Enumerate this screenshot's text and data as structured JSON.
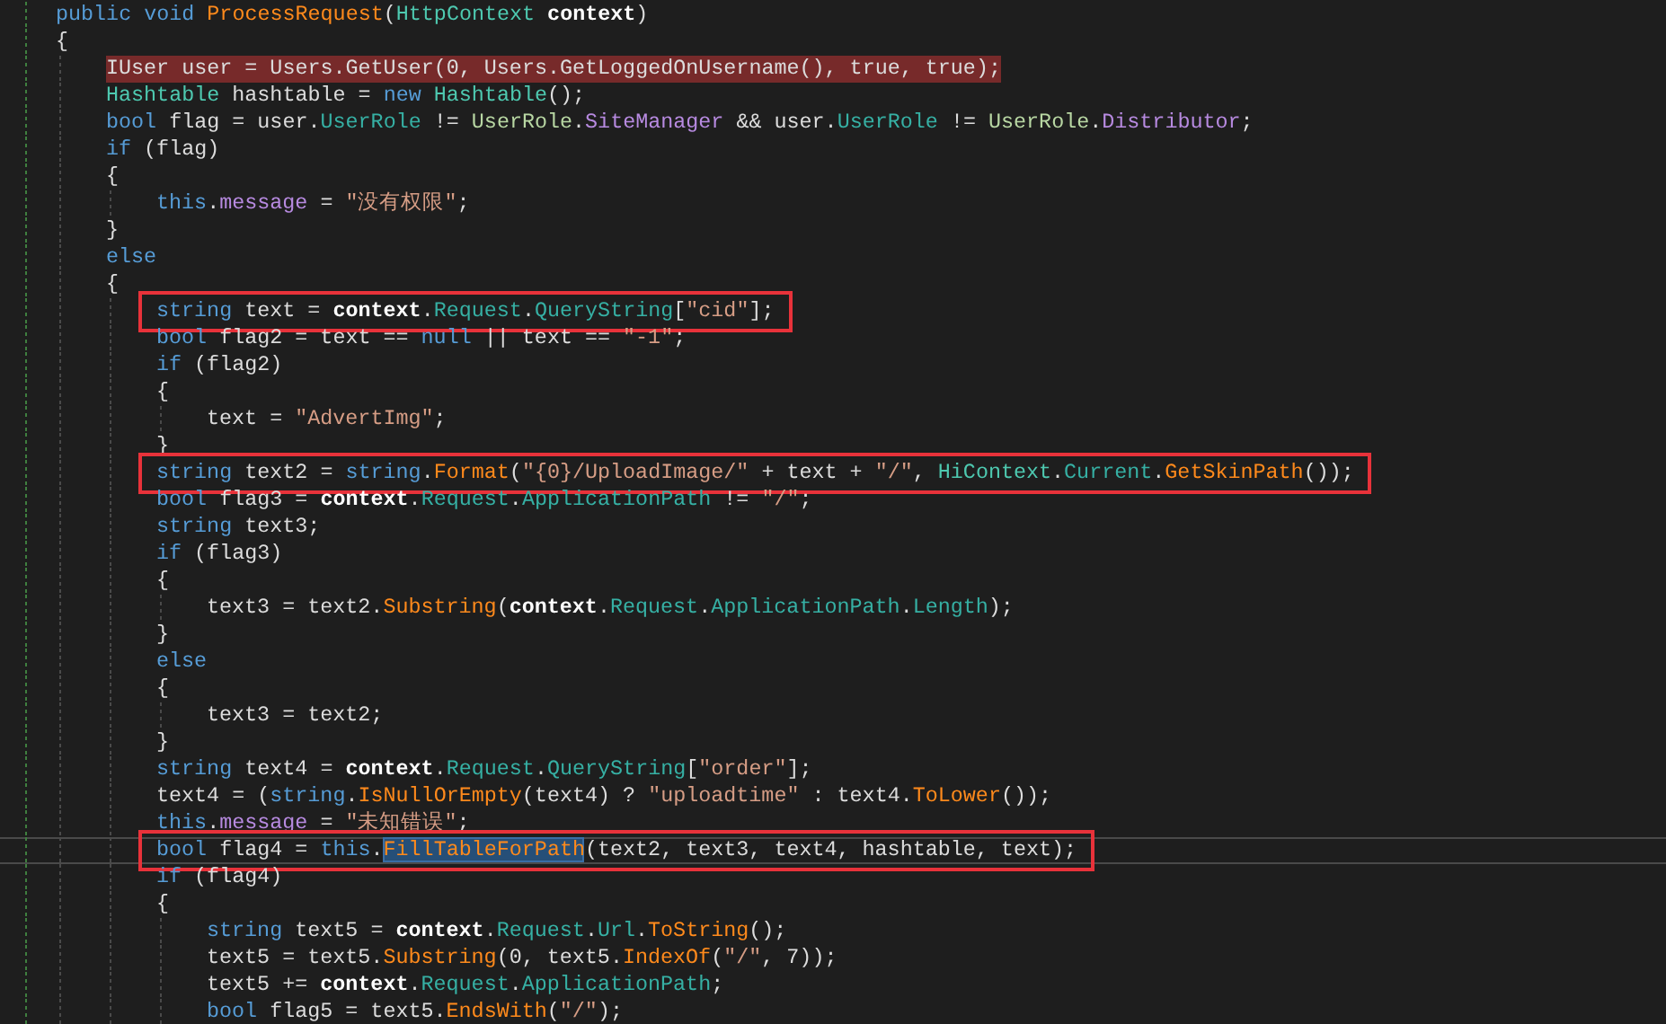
{
  "editor": {
    "lines": [
      {
        "tokens": [
          {
            "text": "public void ",
            "kind": "keyword"
          },
          {
            "text": "ProcessRequest",
            "kind": "method"
          },
          {
            "text": "(",
            "kind": "plain"
          },
          {
            "text": "HttpContext",
            "kind": "type"
          },
          {
            "text": " context",
            "kind": "bold"
          },
          {
            "text": ")",
            "kind": "plain"
          }
        ],
        "breakpoint": false,
        "boxed": false,
        "current": false
      },
      {
        "tokens": [
          {
            "text": "{",
            "kind": "plain"
          }
        ],
        "breakpoint": false,
        "boxed": false,
        "current": false,
        "children": [
          {
            "tokens": [
              {
                "text": "IUser user = Users.GetUser(0, Users.GetLoggedOnUsername(), true, true);",
                "kind": "plain"
              }
            ],
            "breakpoint": true,
            "boxed": false,
            "current": false
          },
          {
            "tokens": [
              {
                "text": "Hashtable",
                "kind": "type"
              },
              {
                "text": " hashtable = ",
                "kind": "plain"
              },
              {
                "text": "new ",
                "kind": "keyword"
              },
              {
                "text": "Hashtable",
                "kind": "type"
              },
              {
                "text": "();",
                "kind": "plain"
              }
            ],
            "breakpoint": false,
            "boxed": false,
            "current": false
          },
          {
            "tokens": [
              {
                "text": "bool ",
                "kind": "keyword"
              },
              {
                "text": "flag = user.",
                "kind": "plain"
              },
              {
                "text": "UserRole",
                "kind": "property"
              },
              {
                "text": " != ",
                "kind": "plain"
              },
              {
                "text": "UserRole",
                "kind": "enumtype"
              },
              {
                "text": ".",
                "kind": "plain"
              },
              {
                "text": "SiteManager",
                "kind": "field"
              },
              {
                "text": " && user.",
                "kind": "plain"
              },
              {
                "text": "UserRole",
                "kind": "property"
              },
              {
                "text": " != ",
                "kind": "plain"
              },
              {
                "text": "UserRole",
                "kind": "enumtype"
              },
              {
                "text": ".",
                "kind": "plain"
              },
              {
                "text": "Distributor",
                "kind": "field"
              },
              {
                "text": ";",
                "kind": "plain"
              }
            ],
            "breakpoint": false,
            "boxed": false,
            "current": false
          },
          {
            "tokens": [
              {
                "text": "if ",
                "kind": "keyword"
              },
              {
                "text": "(flag)",
                "kind": "plain"
              }
            ],
            "breakpoint": false,
            "boxed": false,
            "current": false
          },
          {
            "tokens": [
              {
                "text": "{",
                "kind": "plain"
              }
            ],
            "breakpoint": false,
            "boxed": false,
            "current": false,
            "children": [
              {
                "tokens": [
                  {
                    "text": "this",
                    "kind": "keyword"
                  },
                  {
                    "text": ".",
                    "kind": "plain"
                  },
                  {
                    "text": "message",
                    "kind": "field"
                  },
                  {
                    "text": " = ",
                    "kind": "plain"
                  },
                  {
                    "text": "\"没有权限\"",
                    "kind": "string"
                  },
                  {
                    "text": ";",
                    "kind": "plain"
                  }
                ],
                "breakpoint": false,
                "boxed": false,
                "current": false
              }
            ]
          },
          {
            "tokens": [
              {
                "text": "}",
                "kind": "plain"
              }
            ],
            "breakpoint": false,
            "boxed": false,
            "current": false
          },
          {
            "tokens": [
              {
                "text": "else",
                "kind": "keyword"
              }
            ],
            "breakpoint": false,
            "boxed": false,
            "current": false
          },
          {
            "tokens": [
              {
                "text": "{",
                "kind": "plain"
              }
            ],
            "breakpoint": false,
            "boxed": false,
            "current": false,
            "children": [
              {
                "tokens": [
                  {
                    "text": "string ",
                    "kind": "keyword"
                  },
                  {
                    "text": "text = ",
                    "kind": "plain"
                  },
                  {
                    "text": "context",
                    "kind": "bold"
                  },
                  {
                    "text": ".",
                    "kind": "plain"
                  },
                  {
                    "text": "Request",
                    "kind": "property"
                  },
                  {
                    "text": ".",
                    "kind": "plain"
                  },
                  {
                    "text": "QueryString",
                    "kind": "property"
                  },
                  {
                    "text": "[",
                    "kind": "plain"
                  },
                  {
                    "text": "\"cid\"",
                    "kind": "string"
                  },
                  {
                    "text": "];",
                    "kind": "plain"
                  }
                ],
                "breakpoint": false,
                "boxed": true,
                "current": false
              },
              {
                "tokens": [
                  {
                    "text": "bool ",
                    "kind": "keyword"
                  },
                  {
                    "text": "flag2 = text == ",
                    "kind": "plain"
                  },
                  {
                    "text": "null",
                    "kind": "keyword"
                  },
                  {
                    "text": " || text == ",
                    "kind": "plain"
                  },
                  {
                    "text": "\"-1\"",
                    "kind": "string"
                  },
                  {
                    "text": ";",
                    "kind": "plain"
                  }
                ],
                "breakpoint": false,
                "boxed": false,
                "current": false
              },
              {
                "tokens": [
                  {
                    "text": "if ",
                    "kind": "keyword"
                  },
                  {
                    "text": "(flag2)",
                    "kind": "plain"
                  }
                ],
                "breakpoint": false,
                "boxed": false,
                "current": false
              },
              {
                "tokens": [
                  {
                    "text": "{",
                    "kind": "plain"
                  }
                ],
                "breakpoint": false,
                "boxed": false,
                "current": false,
                "children": [
                  {
                    "tokens": [
                      {
                        "text": "text = ",
                        "kind": "plain"
                      },
                      {
                        "text": "\"AdvertImg\"",
                        "kind": "string"
                      },
                      {
                        "text": ";",
                        "kind": "plain"
                      }
                    ],
                    "breakpoint": false,
                    "boxed": false,
                    "current": false
                  }
                ]
              },
              {
                "tokens": [
                  {
                    "text": "}",
                    "kind": "plain"
                  }
                ],
                "breakpoint": false,
                "boxed": false,
                "current": false
              },
              {
                "tokens": [
                  {
                    "text": "string ",
                    "kind": "keyword"
                  },
                  {
                    "text": "text2 = ",
                    "kind": "plain"
                  },
                  {
                    "text": "string",
                    "kind": "keyword"
                  },
                  {
                    "text": ".",
                    "kind": "plain"
                  },
                  {
                    "text": "Format",
                    "kind": "method"
                  },
                  {
                    "text": "(",
                    "kind": "plain"
                  },
                  {
                    "text": "\"{0}/UploadImage/\"",
                    "kind": "string"
                  },
                  {
                    "text": " + text + ",
                    "kind": "plain"
                  },
                  {
                    "text": "\"/\"",
                    "kind": "string"
                  },
                  {
                    "text": ", ",
                    "kind": "plain"
                  },
                  {
                    "text": "HiContext",
                    "kind": "type"
                  },
                  {
                    "text": ".",
                    "kind": "plain"
                  },
                  {
                    "text": "Current",
                    "kind": "property"
                  },
                  {
                    "text": ".",
                    "kind": "plain"
                  },
                  {
                    "text": "GetSkinPath",
                    "kind": "method"
                  },
                  {
                    "text": "());",
                    "kind": "plain"
                  }
                ],
                "breakpoint": false,
                "boxed": true,
                "current": false
              },
              {
                "tokens": [
                  {
                    "text": "bool ",
                    "kind": "keyword"
                  },
                  {
                    "text": "flag3 = ",
                    "kind": "plain"
                  },
                  {
                    "text": "context",
                    "kind": "bold"
                  },
                  {
                    "text": ".",
                    "kind": "plain"
                  },
                  {
                    "text": "Request",
                    "kind": "property"
                  },
                  {
                    "text": ".",
                    "kind": "plain"
                  },
                  {
                    "text": "ApplicationPath",
                    "kind": "property"
                  },
                  {
                    "text": " != ",
                    "kind": "plain"
                  },
                  {
                    "text": "\"/\"",
                    "kind": "string"
                  },
                  {
                    "text": ";",
                    "kind": "plain"
                  }
                ],
                "breakpoint": false,
                "boxed": false,
                "current": false
              },
              {
                "tokens": [
                  {
                    "text": "string ",
                    "kind": "keyword"
                  },
                  {
                    "text": "text3;",
                    "kind": "plain"
                  }
                ],
                "breakpoint": false,
                "boxed": false,
                "current": false
              },
              {
                "tokens": [
                  {
                    "text": "if ",
                    "kind": "keyword"
                  },
                  {
                    "text": "(flag3)",
                    "kind": "plain"
                  }
                ],
                "breakpoint": false,
                "boxed": false,
                "current": false
              },
              {
                "tokens": [
                  {
                    "text": "{",
                    "kind": "plain"
                  }
                ],
                "breakpoint": false,
                "boxed": false,
                "current": false,
                "children": [
                  {
                    "tokens": [
                      {
                        "text": "text3 = text2.",
                        "kind": "plain"
                      },
                      {
                        "text": "Substring",
                        "kind": "method"
                      },
                      {
                        "text": "(",
                        "kind": "plain"
                      },
                      {
                        "text": "context",
                        "kind": "bold"
                      },
                      {
                        "text": ".",
                        "kind": "plain"
                      },
                      {
                        "text": "Request",
                        "kind": "property"
                      },
                      {
                        "text": ".",
                        "kind": "plain"
                      },
                      {
                        "text": "ApplicationPath",
                        "kind": "property"
                      },
                      {
                        "text": ".",
                        "kind": "plain"
                      },
                      {
                        "text": "Length",
                        "kind": "property"
                      },
                      {
                        "text": ");",
                        "kind": "plain"
                      }
                    ],
                    "breakpoint": false,
                    "boxed": false,
                    "current": false
                  }
                ]
              },
              {
                "tokens": [
                  {
                    "text": "}",
                    "kind": "plain"
                  }
                ],
                "breakpoint": false,
                "boxed": false,
                "current": false
              },
              {
                "tokens": [
                  {
                    "text": "else",
                    "kind": "keyword"
                  }
                ],
                "breakpoint": false,
                "boxed": false,
                "current": false
              },
              {
                "tokens": [
                  {
                    "text": "{",
                    "kind": "plain"
                  }
                ],
                "breakpoint": false,
                "boxed": false,
                "current": false,
                "children": [
                  {
                    "tokens": [
                      {
                        "text": "text3 = text2;",
                        "kind": "plain"
                      }
                    ],
                    "breakpoint": false,
                    "boxed": false,
                    "current": false
                  }
                ]
              },
              {
                "tokens": [
                  {
                    "text": "}",
                    "kind": "plain"
                  }
                ],
                "breakpoint": false,
                "boxed": false,
                "current": false
              },
              {
                "tokens": [
                  {
                    "text": "string ",
                    "kind": "keyword"
                  },
                  {
                    "text": "text4 = ",
                    "kind": "plain"
                  },
                  {
                    "text": "context",
                    "kind": "bold"
                  },
                  {
                    "text": ".",
                    "kind": "plain"
                  },
                  {
                    "text": "Request",
                    "kind": "property"
                  },
                  {
                    "text": ".",
                    "kind": "plain"
                  },
                  {
                    "text": "QueryString",
                    "kind": "property"
                  },
                  {
                    "text": "[",
                    "kind": "plain"
                  },
                  {
                    "text": "\"order\"",
                    "kind": "string"
                  },
                  {
                    "text": "];",
                    "kind": "plain"
                  }
                ],
                "breakpoint": false,
                "boxed": false,
                "current": false
              },
              {
                "tokens": [
                  {
                    "text": "text4 = (",
                    "kind": "plain"
                  },
                  {
                    "text": "string",
                    "kind": "keyword"
                  },
                  {
                    "text": ".",
                    "kind": "plain"
                  },
                  {
                    "text": "IsNullOrEmpty",
                    "kind": "method"
                  },
                  {
                    "text": "(text4) ? ",
                    "kind": "plain"
                  },
                  {
                    "text": "\"uploadtime\"",
                    "kind": "string"
                  },
                  {
                    "text": " : text4.",
                    "kind": "plain"
                  },
                  {
                    "text": "ToLower",
                    "kind": "method"
                  },
                  {
                    "text": "());",
                    "kind": "plain"
                  }
                ],
                "breakpoint": false,
                "boxed": false,
                "current": false
              },
              {
                "tokens": [
                  {
                    "text": "this",
                    "kind": "keyword"
                  },
                  {
                    "text": ".",
                    "kind": "plain"
                  },
                  {
                    "text": "message",
                    "kind": "field"
                  },
                  {
                    "text": " = ",
                    "kind": "plain"
                  },
                  {
                    "text": "\"未知错误\"",
                    "kind": "string"
                  },
                  {
                    "text": ";",
                    "kind": "plain"
                  }
                ],
                "breakpoint": false,
                "boxed": false,
                "current": false
              },
              {
                "tokens": [
                  {
                    "text": "bool ",
                    "kind": "keyword"
                  },
                  {
                    "text": "flag4 = ",
                    "kind": "plain"
                  },
                  {
                    "text": "this",
                    "kind": "keyword"
                  },
                  {
                    "text": ".",
                    "kind": "plain"
                  },
                  {
                    "text": "FillTableForPath",
                    "kind": "selection"
                  },
                  {
                    "text": "(text2, text3, text4, hashtable, text);",
                    "kind": "plain"
                  }
                ],
                "breakpoint": false,
                "boxed": true,
                "current": true
              },
              {
                "tokens": [
                  {
                    "text": "if ",
                    "kind": "keyword"
                  },
                  {
                    "text": "(flag4)",
                    "kind": "plain"
                  }
                ],
                "breakpoint": false,
                "boxed": false,
                "current": false
              },
              {
                "tokens": [
                  {
                    "text": "{",
                    "kind": "plain"
                  }
                ],
                "breakpoint": false,
                "boxed": false,
                "current": false,
                "children": [
                  {
                    "tokens": [
                      {
                        "text": "string ",
                        "kind": "keyword"
                      },
                      {
                        "text": "text5 = ",
                        "kind": "plain"
                      },
                      {
                        "text": "context",
                        "kind": "bold"
                      },
                      {
                        "text": ".",
                        "kind": "plain"
                      },
                      {
                        "text": "Request",
                        "kind": "property"
                      },
                      {
                        "text": ".",
                        "kind": "plain"
                      },
                      {
                        "text": "Url",
                        "kind": "property"
                      },
                      {
                        "text": ".",
                        "kind": "plain"
                      },
                      {
                        "text": "ToString",
                        "kind": "method"
                      },
                      {
                        "text": "();",
                        "kind": "plain"
                      }
                    ],
                    "breakpoint": false,
                    "boxed": false,
                    "current": false
                  },
                  {
                    "tokens": [
                      {
                        "text": "text5 = text5.",
                        "kind": "plain"
                      },
                      {
                        "text": "Substring",
                        "kind": "method"
                      },
                      {
                        "text": "(0, text5.",
                        "kind": "plain"
                      },
                      {
                        "text": "IndexOf",
                        "kind": "method"
                      },
                      {
                        "text": "(",
                        "kind": "plain"
                      },
                      {
                        "text": "\"/\"",
                        "kind": "string"
                      },
                      {
                        "text": ", 7));",
                        "kind": "plain"
                      }
                    ],
                    "breakpoint": false,
                    "boxed": false,
                    "current": false
                  },
                  {
                    "tokens": [
                      {
                        "text": "text5 += ",
                        "kind": "plain"
                      },
                      {
                        "text": "context",
                        "kind": "bold"
                      },
                      {
                        "text": ".",
                        "kind": "plain"
                      },
                      {
                        "text": "Request",
                        "kind": "property"
                      },
                      {
                        "text": ".",
                        "kind": "plain"
                      },
                      {
                        "text": "ApplicationPath",
                        "kind": "property"
                      },
                      {
                        "text": ";",
                        "kind": "plain"
                      }
                    ],
                    "breakpoint": false,
                    "boxed": false,
                    "current": false
                  },
                  {
                    "tokens": [
                      {
                        "text": "bool ",
                        "kind": "keyword"
                      },
                      {
                        "text": "flag5 = text5.",
                        "kind": "plain"
                      },
                      {
                        "text": "EndsWith",
                        "kind": "method"
                      },
                      {
                        "text": "(",
                        "kind": "plain"
                      },
                      {
                        "text": "\"/\"",
                        "kind": "string"
                      },
                      {
                        "text": ");",
                        "kind": "plain"
                      }
                    ],
                    "breakpoint": false,
                    "boxed": false,
                    "current": false
                  }
                ]
              }
            ]
          }
        ]
      }
    ]
  }
}
